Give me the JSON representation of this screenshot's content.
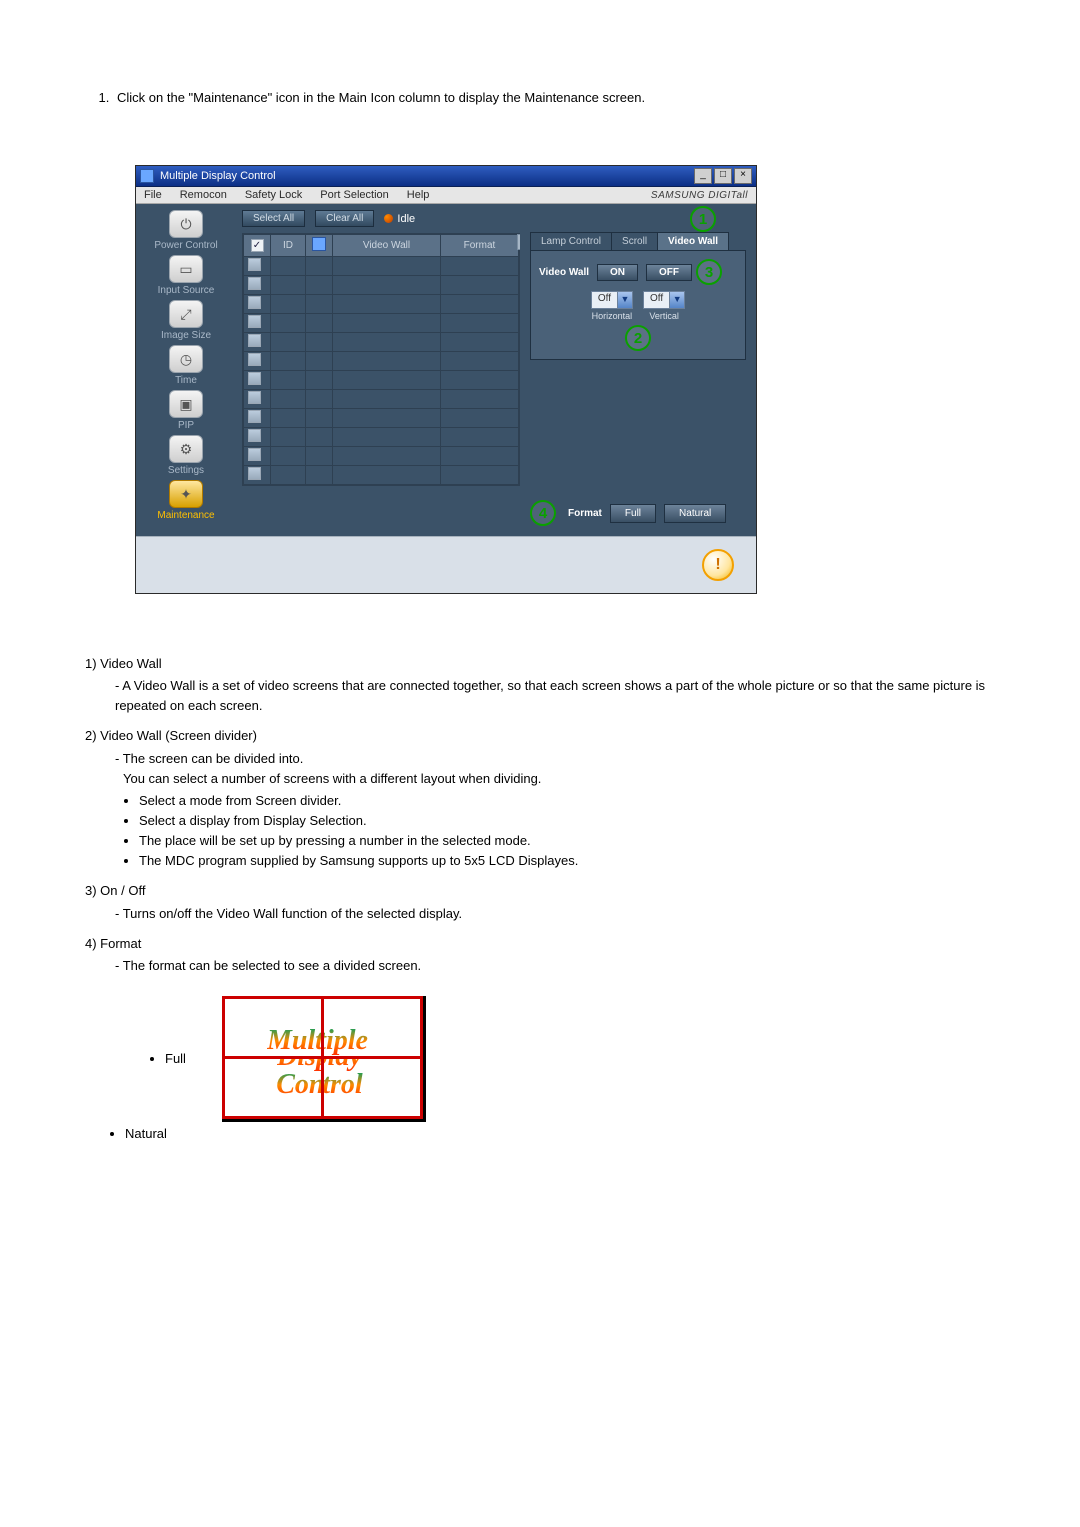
{
  "intro": "Click on the \"Maintenance\" icon in the Main Icon column to display the Maintenance screen.",
  "window": {
    "title": "Multiple Display Control",
    "brand": "SAMSUNG DIGITall"
  },
  "menu": {
    "file": "File",
    "remocon": "Remocon",
    "safety_lock": "Safety Lock",
    "port_selection": "Port Selection",
    "help": "Help"
  },
  "sidebar": {
    "power": "Power Control",
    "input": "Input Source",
    "image": "Image Size",
    "time": "Time",
    "pip": "PIP",
    "settings": "Settings",
    "maintenance": "Maintenance"
  },
  "toolbar": {
    "select_all": "Select All",
    "clear_all": "Clear All",
    "idle": "Idle"
  },
  "table": {
    "col_id": "ID",
    "col_video_wall": "Video Wall",
    "col_format": "Format"
  },
  "tabs": {
    "lamp": "Lamp Control",
    "scroll": "Scroll",
    "video_wall": "Video Wall"
  },
  "panel": {
    "label_video_wall": "Video Wall",
    "on": "ON",
    "off": "OFF",
    "horizontal": "Horizontal",
    "vertical": "Vertical",
    "dd_off": "Off"
  },
  "format": {
    "label": "Format",
    "full": "Full",
    "natural": "Natural"
  },
  "callouts": {
    "c1": "1",
    "c2": "2",
    "c3": "3",
    "c4": "4"
  },
  "desc": {
    "s1_title": "1)  Video Wall",
    "s1_a": "A Video Wall is a set of video screens that are connected together, so that each screen shows a part of the whole picture or so that the same picture is repeated on each screen.",
    "s2_title": "2)  Video Wall (Screen divider)",
    "s2_a": "The screen can be divided into.",
    "s2_b": "You can select a number of screens with a different layout when dividing.",
    "s2_bul1": "Select a mode from Screen divider.",
    "s2_bul2": "Select a display from Display Selection.",
    "s2_bul3": "The place will be set up by pressing a number in the selected mode.",
    "s2_bul4": "The MDC program supplied by Samsung supports up to 5x5 LCD Displayes.",
    "s3_title": "3)  On / Off",
    "s3_a": "Turns on/off the Video Wall function of the selected display.",
    "s4_title": "4)  Format",
    "s4_a": "The format can be selected to see a divided screen.",
    "full_label": "Full",
    "natural_label": "Natural",
    "fig_w1": "Multiple",
    "fig_w2": "Display",
    "fig_w3": "Control"
  }
}
